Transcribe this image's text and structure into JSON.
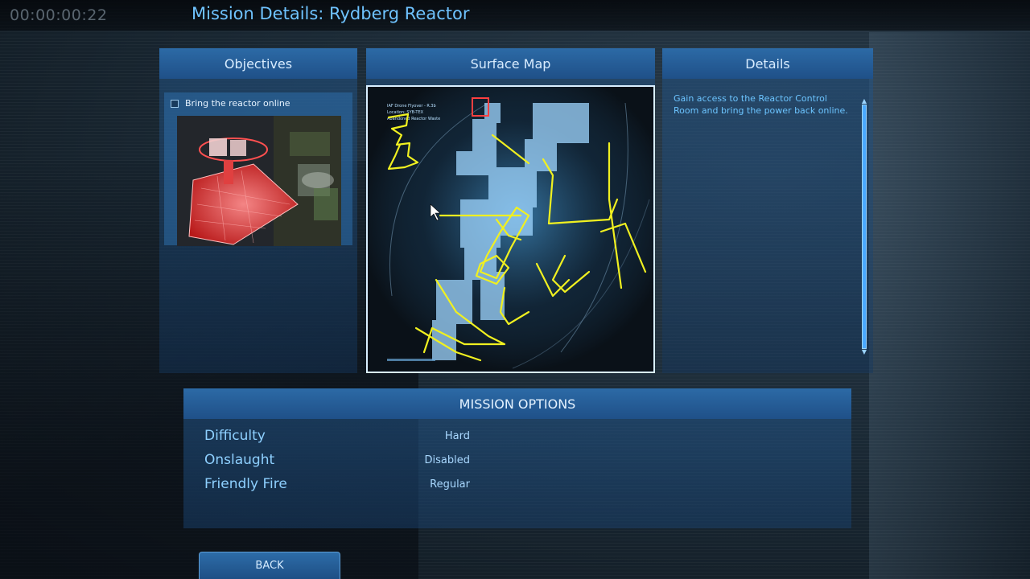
{
  "hud": {
    "timer": "00:00:00:22",
    "title": "Mission Details: Rydberg Reactor"
  },
  "objectives": {
    "header": "Objectives",
    "items": [
      {
        "label": "Bring the reactor online",
        "checked": false
      }
    ]
  },
  "surface_map": {
    "header": "Surface Map",
    "overlay_text": "Location: SYB-TEX"
  },
  "details": {
    "header": "Details",
    "text": "Gain access to the Reactor Control Room and bring the power back online."
  },
  "mission_options": {
    "header": "MISSION OPTIONS",
    "options": [
      {
        "label": "Difficulty",
        "value": "Hard"
      },
      {
        "label": "Onslaught",
        "value": "Disabled"
      },
      {
        "label": "Friendly Fire",
        "value": "Regular"
      }
    ]
  },
  "back_label": "BACK",
  "colors": {
    "accent": "#6fc3ff",
    "panel_header": "#2c6aa6",
    "scribble": "#f0f020"
  }
}
